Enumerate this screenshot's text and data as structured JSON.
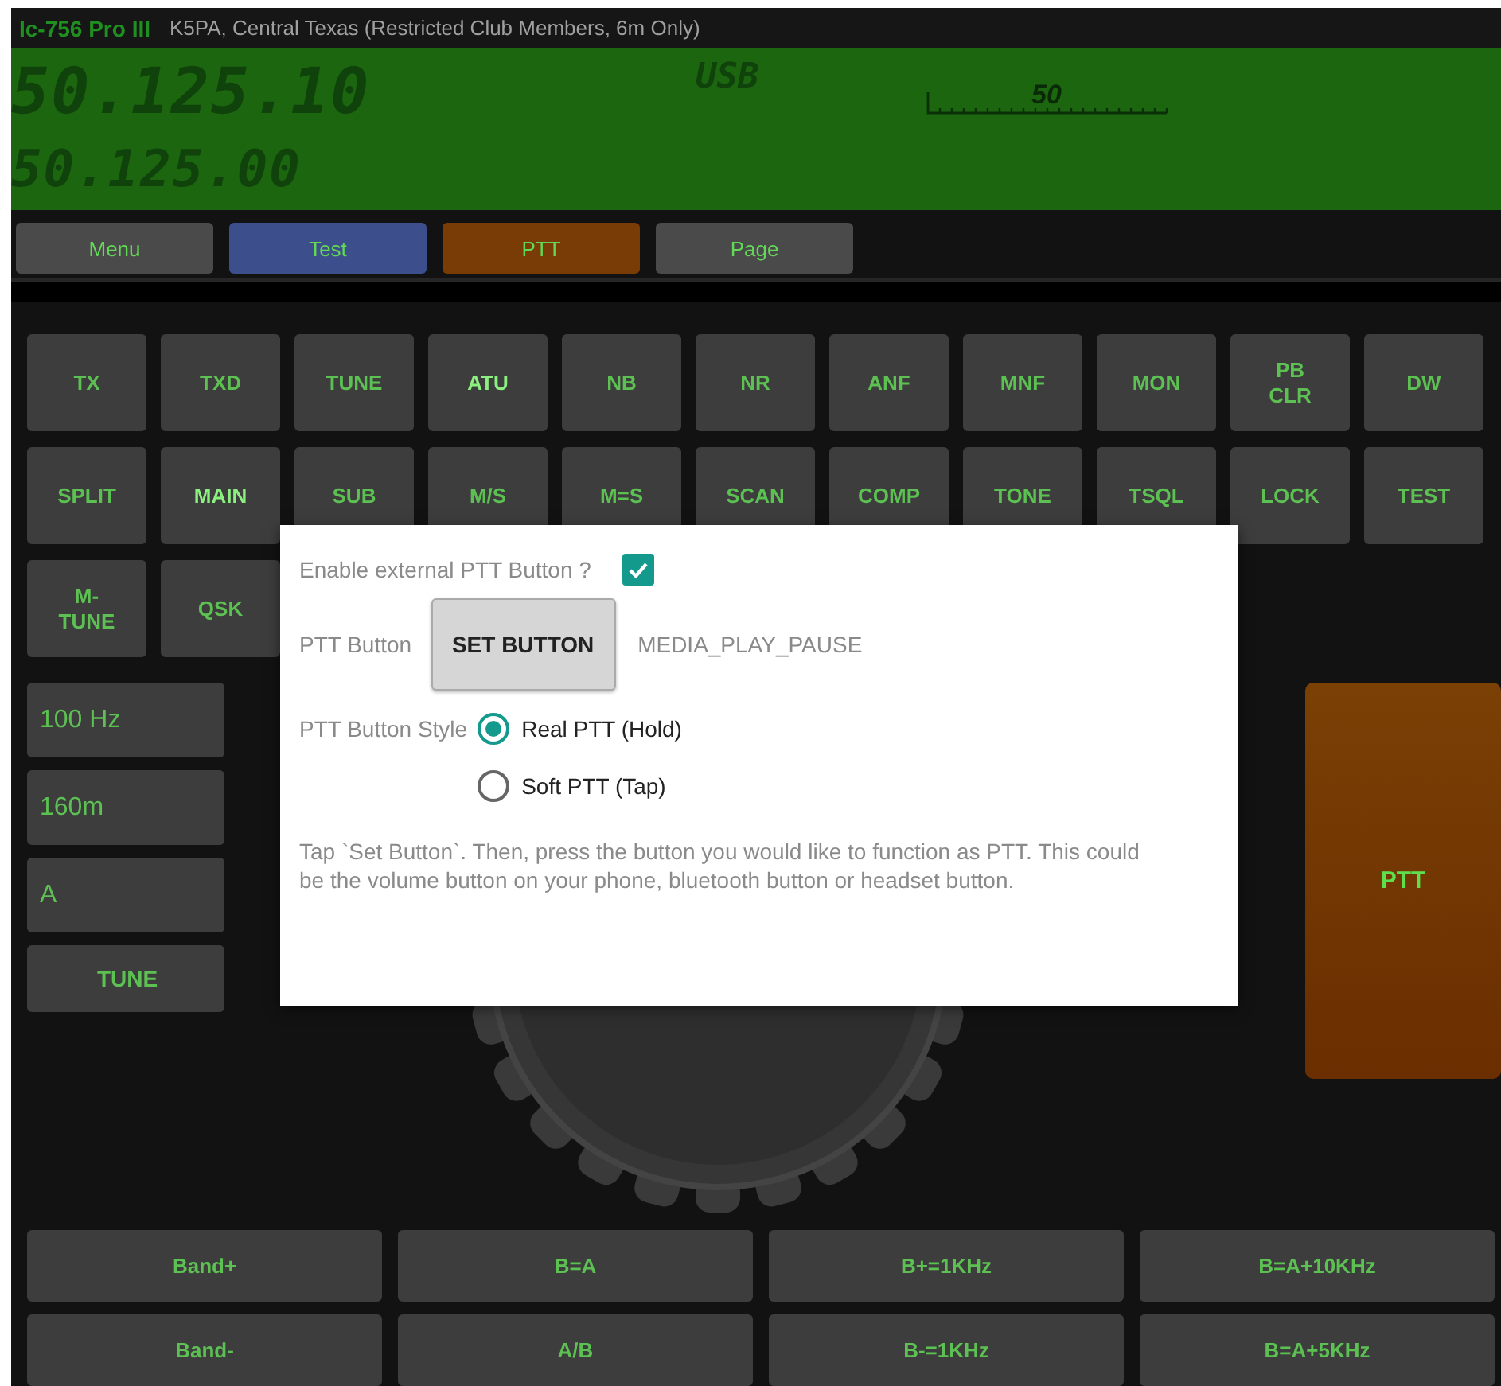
{
  "title_bar": {
    "app_name": "Ic-756 Pro III",
    "station": "K5PA, Central Texas (Restricted Club Members, 6m Only)"
  },
  "display": {
    "frequency_main": "50.125.10",
    "frequency_sub": "50.125.00",
    "mode": "USB",
    "meter_reading": "50"
  },
  "toolbar": [
    {
      "label": "Menu",
      "kind": "grey"
    },
    {
      "label": "Test",
      "kind": "blue"
    },
    {
      "label": "PTT",
      "kind": "orange"
    },
    {
      "label": "Page",
      "kind": "grey"
    }
  ],
  "function_buttons": [
    [
      {
        "label": "TX",
        "on": false
      },
      {
        "label": "TXD",
        "on": false
      },
      {
        "label": "TUNE",
        "on": false
      },
      {
        "label": "ATU",
        "on": true
      },
      {
        "label": "NB",
        "on": false
      },
      {
        "label": "NR",
        "on": false
      },
      {
        "label": "ANF",
        "on": false
      },
      {
        "label": "MNF",
        "on": false
      },
      {
        "label": "MON",
        "on": false
      },
      {
        "label": "PB\nCLR",
        "on": false
      },
      {
        "label": "DW",
        "on": false
      }
    ],
    [
      {
        "label": "SPLIT",
        "on": false
      },
      {
        "label": "MAIN",
        "on": true
      },
      {
        "label": "SUB",
        "on": false
      },
      {
        "label": "M/S",
        "on": false
      },
      {
        "label": "M=S",
        "on": false
      },
      {
        "label": "SCAN",
        "on": false
      },
      {
        "label": "COMP",
        "on": false
      },
      {
        "label": "TONE",
        "on": false
      },
      {
        "label": "TSQL",
        "on": false
      },
      {
        "label": "LOCK",
        "on": false
      },
      {
        "label": "TEST",
        "on": false
      }
    ],
    [
      {
        "label": "M-\nTUNE",
        "on": false
      },
      {
        "label": "QSK",
        "on": false
      }
    ]
  ],
  "side_buttons": [
    {
      "label": "100 Hz",
      "kind": "value"
    },
    {
      "label": "160m",
      "kind": "value"
    },
    {
      "label": "A",
      "kind": "value"
    },
    {
      "label": "TUNE",
      "kind": "action"
    }
  ],
  "big_ptt": {
    "label": "PTT"
  },
  "bottom_buttons": [
    {
      "label": "Band+"
    },
    {
      "label": "B=A"
    },
    {
      "label": "B+=1KHz"
    },
    {
      "label": "B=A+10KHz"
    },
    {
      "label": "Band-"
    },
    {
      "label": "A/B"
    },
    {
      "label": "B-=1KHz"
    },
    {
      "label": "B=A+5KHz"
    }
  ],
  "dialog": {
    "checkbox_label": "Enable external PTT Button ?",
    "enabled": true,
    "ptt_button_label": "PTT Button",
    "set_button": "SET BUTTON",
    "key_name": "MEDIA_PLAY_PAUSE",
    "style_label": "PTT Button Style",
    "style_options": [
      {
        "label": "Real PTT (Hold)",
        "selected": true
      },
      {
        "label": "Soft PTT (Tap)",
        "selected": false
      }
    ],
    "help": "Tap `Set Button`. Then, press the button you would like to function as PTT. This could be the volume button on your phone, bluetooth button or headset button."
  }
}
